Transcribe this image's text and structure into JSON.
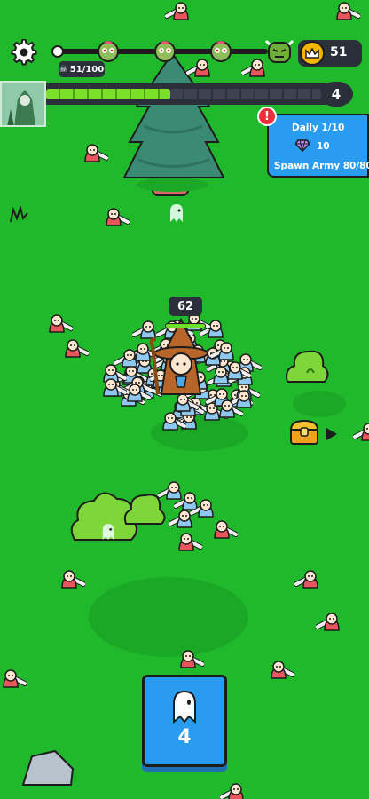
{
  "hud": {
    "settings_icon": "gear-icon",
    "wave_icons": [
      "zombie-head-icon",
      "zombie-head-icon",
      "zombie-head-icon",
      "zombie-boss-icon"
    ],
    "kill_counter": "51/100",
    "coins": "51",
    "hero_level": "4",
    "xp_fraction": 0.45
  },
  "daily_quest": {
    "title": "Daily 1/10",
    "reward": "10",
    "task": "Spawn Army 80/80",
    "alert": "!"
  },
  "army": {
    "count": "62",
    "hp_fraction": 1.0
  },
  "spawn_card": {
    "count": "4",
    "icon": "ghost-icon"
  },
  "colors": {
    "grass": "#20b92b",
    "panel": "#2b2f3a",
    "accent_blue": "#2a9cf0",
    "xp_green": "#7be02a",
    "alert_red": "#e8303a",
    "coin_gold": "#f5b400"
  }
}
